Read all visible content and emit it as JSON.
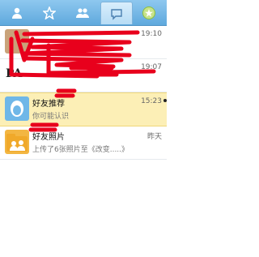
{
  "tabs": [
    {
      "name": "contacts-tab",
      "icon": "person-icon"
    },
    {
      "name": "favorites-tab",
      "icon": "star-icon"
    },
    {
      "name": "groups-tab",
      "icon": "group-icon"
    },
    {
      "name": "messages-tab",
      "icon": "chat-bubble-icon",
      "active": true
    },
    {
      "name": "qzone-tab",
      "icon": "qzone-star-icon"
    }
  ],
  "messages": [
    {
      "title": "",
      "subtitle": "",
      "time": "19:10"
    },
    {
      "title": "PA",
      "subtitle": "",
      "time": "19:07"
    },
    {
      "title": "好友推荐",
      "subtitle": "你可能认识",
      "time": "15:23"
    },
    {
      "title": "好友照片",
      "subtitle": "上传了6张照片至《改变.....》",
      "time": "昨天"
    }
  ],
  "colors": {
    "accent": "#5fa9dd",
    "selected_row": "#fcefb6",
    "redaction": "#e8001c"
  }
}
